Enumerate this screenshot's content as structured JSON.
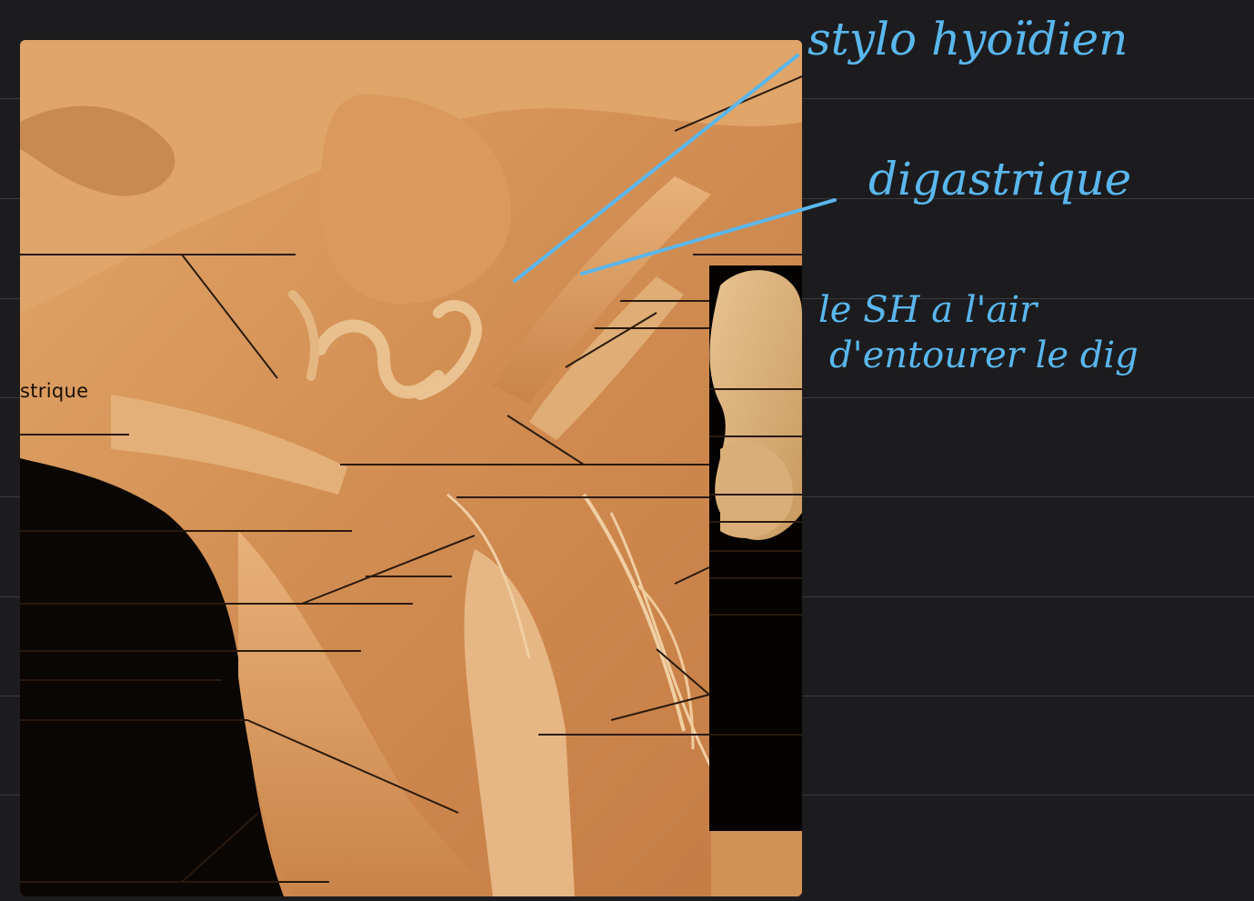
{
  "photo": {
    "label": "strique"
  },
  "annotations": {
    "stylo_hyoidien": "stylo hyoïdien",
    "digastrique": "digastrique",
    "note_line1": "le SH a l'air",
    "note_line2": "d'entourer le dig"
  },
  "colors": {
    "background": "#1c1c1e",
    "ink": "#5ab7ee",
    "tissue": "#d89a5e"
  }
}
